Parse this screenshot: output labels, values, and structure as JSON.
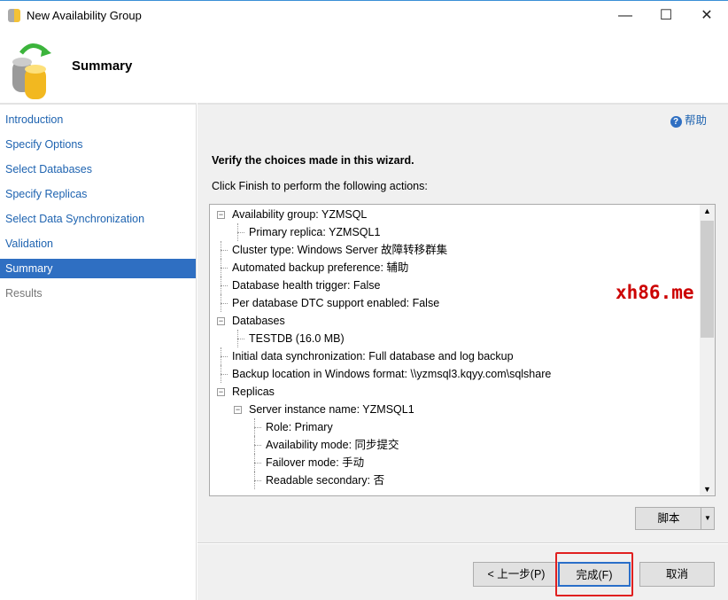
{
  "window": {
    "title": "New Availability Group",
    "minimize": "—",
    "maximize": "☐",
    "close": "✕"
  },
  "header": {
    "title": "Summary"
  },
  "sidebar": {
    "items": [
      {
        "label": "Introduction",
        "state": "link"
      },
      {
        "label": "Specify Options",
        "state": "link"
      },
      {
        "label": "Select Databases",
        "state": "link"
      },
      {
        "label": "Specify Replicas",
        "state": "link"
      },
      {
        "label": "Select Data Synchronization",
        "state": "link"
      },
      {
        "label": "Validation",
        "state": "link"
      },
      {
        "label": "Summary",
        "state": "active"
      },
      {
        "label": "Results",
        "state": "disabled"
      }
    ]
  },
  "main": {
    "help": "帮助",
    "verify": "Verify the choices made in this wizard.",
    "instruction": "Click Finish to perform the following actions:",
    "tree": [
      {
        "text": "Availability group: YZMSQL",
        "level": 0,
        "expander": true
      },
      {
        "text": "Primary replica: YZMSQL1",
        "level": 1
      },
      {
        "text": "Cluster type: Windows Server 故障转移群集",
        "level": 0
      },
      {
        "text": "Automated backup preference: 辅助",
        "level": 0
      },
      {
        "text": "Database health trigger: False",
        "level": 0
      },
      {
        "text": "Per database DTC support enabled: False",
        "level": 0
      },
      {
        "text": "Databases",
        "level": 0,
        "expander": true
      },
      {
        "text": "TESTDB (16.0 MB)",
        "level": 1
      },
      {
        "text": "Initial data synchronization: Full database and log backup",
        "level": 0
      },
      {
        "text": "Backup location in Windows format: \\\\yzmsql3.kqyy.com\\sqlshare",
        "level": 0
      },
      {
        "text": "Replicas",
        "level": 0,
        "expander": true
      },
      {
        "text": "Server instance name: YZMSQL1",
        "level": 1,
        "expander": true
      },
      {
        "text": "Role: Primary",
        "level": 2
      },
      {
        "text": "Availability mode: 同步提交",
        "level": 2
      },
      {
        "text": "Failover mode: 手动",
        "level": 2
      },
      {
        "text": "Readable secondary: 否",
        "level": 2
      }
    ]
  },
  "buttons": {
    "script": "脚本",
    "previous": "< 上一步(P)",
    "finish": "完成(F)",
    "cancel": "取消"
  },
  "watermark": "xh86.me"
}
